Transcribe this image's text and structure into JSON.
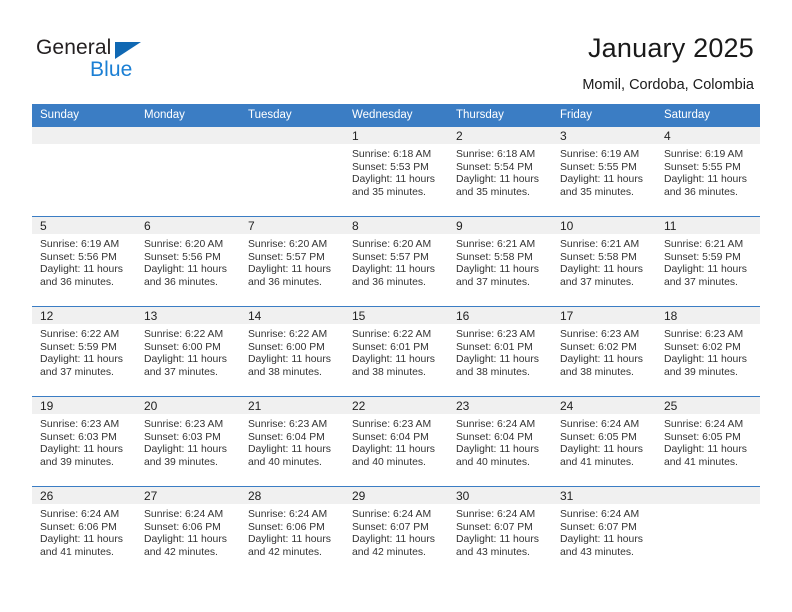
{
  "brand": {
    "name_part1": "General",
    "name_part2": "Blue",
    "triangle_color": "#1068b3",
    "blue_color": "#1b7fd4"
  },
  "header": {
    "title": "January 2025",
    "subtitle": "Momil, Cordoba, Colombia"
  },
  "theme": {
    "header_blue": "#3b7dc4",
    "daynum_band": "#f0f0f0",
    "text": "#333333"
  },
  "calendar": {
    "weekday_headers": [
      "Sunday",
      "Monday",
      "Tuesday",
      "Wednesday",
      "Thursday",
      "Friday",
      "Saturday"
    ],
    "weeks": [
      [
        {
          "day": "",
          "sunrise": "",
          "sunset": "",
          "daylight1": "",
          "daylight2": ""
        },
        {
          "day": "",
          "sunrise": "",
          "sunset": "",
          "daylight1": "",
          "daylight2": ""
        },
        {
          "day": "",
          "sunrise": "",
          "sunset": "",
          "daylight1": "",
          "daylight2": ""
        },
        {
          "day": "1",
          "sunrise": "Sunrise: 6:18 AM",
          "sunset": "Sunset: 5:53 PM",
          "daylight1": "Daylight: 11 hours",
          "daylight2": "and 35 minutes."
        },
        {
          "day": "2",
          "sunrise": "Sunrise: 6:18 AM",
          "sunset": "Sunset: 5:54 PM",
          "daylight1": "Daylight: 11 hours",
          "daylight2": "and 35 minutes."
        },
        {
          "day": "3",
          "sunrise": "Sunrise: 6:19 AM",
          "sunset": "Sunset: 5:55 PM",
          "daylight1": "Daylight: 11 hours",
          "daylight2": "and 35 minutes."
        },
        {
          "day": "4",
          "sunrise": "Sunrise: 6:19 AM",
          "sunset": "Sunset: 5:55 PM",
          "daylight1": "Daylight: 11 hours",
          "daylight2": "and 36 minutes."
        }
      ],
      [
        {
          "day": "5",
          "sunrise": "Sunrise: 6:19 AM",
          "sunset": "Sunset: 5:56 PM",
          "daylight1": "Daylight: 11 hours",
          "daylight2": "and 36 minutes."
        },
        {
          "day": "6",
          "sunrise": "Sunrise: 6:20 AM",
          "sunset": "Sunset: 5:56 PM",
          "daylight1": "Daylight: 11 hours",
          "daylight2": "and 36 minutes."
        },
        {
          "day": "7",
          "sunrise": "Sunrise: 6:20 AM",
          "sunset": "Sunset: 5:57 PM",
          "daylight1": "Daylight: 11 hours",
          "daylight2": "and 36 minutes."
        },
        {
          "day": "8",
          "sunrise": "Sunrise: 6:20 AM",
          "sunset": "Sunset: 5:57 PM",
          "daylight1": "Daylight: 11 hours",
          "daylight2": "and 36 minutes."
        },
        {
          "day": "9",
          "sunrise": "Sunrise: 6:21 AM",
          "sunset": "Sunset: 5:58 PM",
          "daylight1": "Daylight: 11 hours",
          "daylight2": "and 37 minutes."
        },
        {
          "day": "10",
          "sunrise": "Sunrise: 6:21 AM",
          "sunset": "Sunset: 5:58 PM",
          "daylight1": "Daylight: 11 hours",
          "daylight2": "and 37 minutes."
        },
        {
          "day": "11",
          "sunrise": "Sunrise: 6:21 AM",
          "sunset": "Sunset: 5:59 PM",
          "daylight1": "Daylight: 11 hours",
          "daylight2": "and 37 minutes."
        }
      ],
      [
        {
          "day": "12",
          "sunrise": "Sunrise: 6:22 AM",
          "sunset": "Sunset: 5:59 PM",
          "daylight1": "Daylight: 11 hours",
          "daylight2": "and 37 minutes."
        },
        {
          "day": "13",
          "sunrise": "Sunrise: 6:22 AM",
          "sunset": "Sunset: 6:00 PM",
          "daylight1": "Daylight: 11 hours",
          "daylight2": "and 37 minutes."
        },
        {
          "day": "14",
          "sunrise": "Sunrise: 6:22 AM",
          "sunset": "Sunset: 6:00 PM",
          "daylight1": "Daylight: 11 hours",
          "daylight2": "and 38 minutes."
        },
        {
          "day": "15",
          "sunrise": "Sunrise: 6:22 AM",
          "sunset": "Sunset: 6:01 PM",
          "daylight1": "Daylight: 11 hours",
          "daylight2": "and 38 minutes."
        },
        {
          "day": "16",
          "sunrise": "Sunrise: 6:23 AM",
          "sunset": "Sunset: 6:01 PM",
          "daylight1": "Daylight: 11 hours",
          "daylight2": "and 38 minutes."
        },
        {
          "day": "17",
          "sunrise": "Sunrise: 6:23 AM",
          "sunset": "Sunset: 6:02 PM",
          "daylight1": "Daylight: 11 hours",
          "daylight2": "and 38 minutes."
        },
        {
          "day": "18",
          "sunrise": "Sunrise: 6:23 AM",
          "sunset": "Sunset: 6:02 PM",
          "daylight1": "Daylight: 11 hours",
          "daylight2": "and 39 minutes."
        }
      ],
      [
        {
          "day": "19",
          "sunrise": "Sunrise: 6:23 AM",
          "sunset": "Sunset: 6:03 PM",
          "daylight1": "Daylight: 11 hours",
          "daylight2": "and 39 minutes."
        },
        {
          "day": "20",
          "sunrise": "Sunrise: 6:23 AM",
          "sunset": "Sunset: 6:03 PM",
          "daylight1": "Daylight: 11 hours",
          "daylight2": "and 39 minutes."
        },
        {
          "day": "21",
          "sunrise": "Sunrise: 6:23 AM",
          "sunset": "Sunset: 6:04 PM",
          "daylight1": "Daylight: 11 hours",
          "daylight2": "and 40 minutes."
        },
        {
          "day": "22",
          "sunrise": "Sunrise: 6:23 AM",
          "sunset": "Sunset: 6:04 PM",
          "daylight1": "Daylight: 11 hours",
          "daylight2": "and 40 minutes."
        },
        {
          "day": "23",
          "sunrise": "Sunrise: 6:24 AM",
          "sunset": "Sunset: 6:04 PM",
          "daylight1": "Daylight: 11 hours",
          "daylight2": "and 40 minutes."
        },
        {
          "day": "24",
          "sunrise": "Sunrise: 6:24 AM",
          "sunset": "Sunset: 6:05 PM",
          "daylight1": "Daylight: 11 hours",
          "daylight2": "and 41 minutes."
        },
        {
          "day": "25",
          "sunrise": "Sunrise: 6:24 AM",
          "sunset": "Sunset: 6:05 PM",
          "daylight1": "Daylight: 11 hours",
          "daylight2": "and 41 minutes."
        }
      ],
      [
        {
          "day": "26",
          "sunrise": "Sunrise: 6:24 AM",
          "sunset": "Sunset: 6:06 PM",
          "daylight1": "Daylight: 11 hours",
          "daylight2": "and 41 minutes."
        },
        {
          "day": "27",
          "sunrise": "Sunrise: 6:24 AM",
          "sunset": "Sunset: 6:06 PM",
          "daylight1": "Daylight: 11 hours",
          "daylight2": "and 42 minutes."
        },
        {
          "day": "28",
          "sunrise": "Sunrise: 6:24 AM",
          "sunset": "Sunset: 6:06 PM",
          "daylight1": "Daylight: 11 hours",
          "daylight2": "and 42 minutes."
        },
        {
          "day": "29",
          "sunrise": "Sunrise: 6:24 AM",
          "sunset": "Sunset: 6:07 PM",
          "daylight1": "Daylight: 11 hours",
          "daylight2": "and 42 minutes."
        },
        {
          "day": "30",
          "sunrise": "Sunrise: 6:24 AM",
          "sunset": "Sunset: 6:07 PM",
          "daylight1": "Daylight: 11 hours",
          "daylight2": "and 43 minutes."
        },
        {
          "day": "31",
          "sunrise": "Sunrise: 6:24 AM",
          "sunset": "Sunset: 6:07 PM",
          "daylight1": "Daylight: 11 hours",
          "daylight2": "and 43 minutes."
        },
        {
          "day": "",
          "sunrise": "",
          "sunset": "",
          "daylight1": "",
          "daylight2": ""
        }
      ]
    ]
  }
}
